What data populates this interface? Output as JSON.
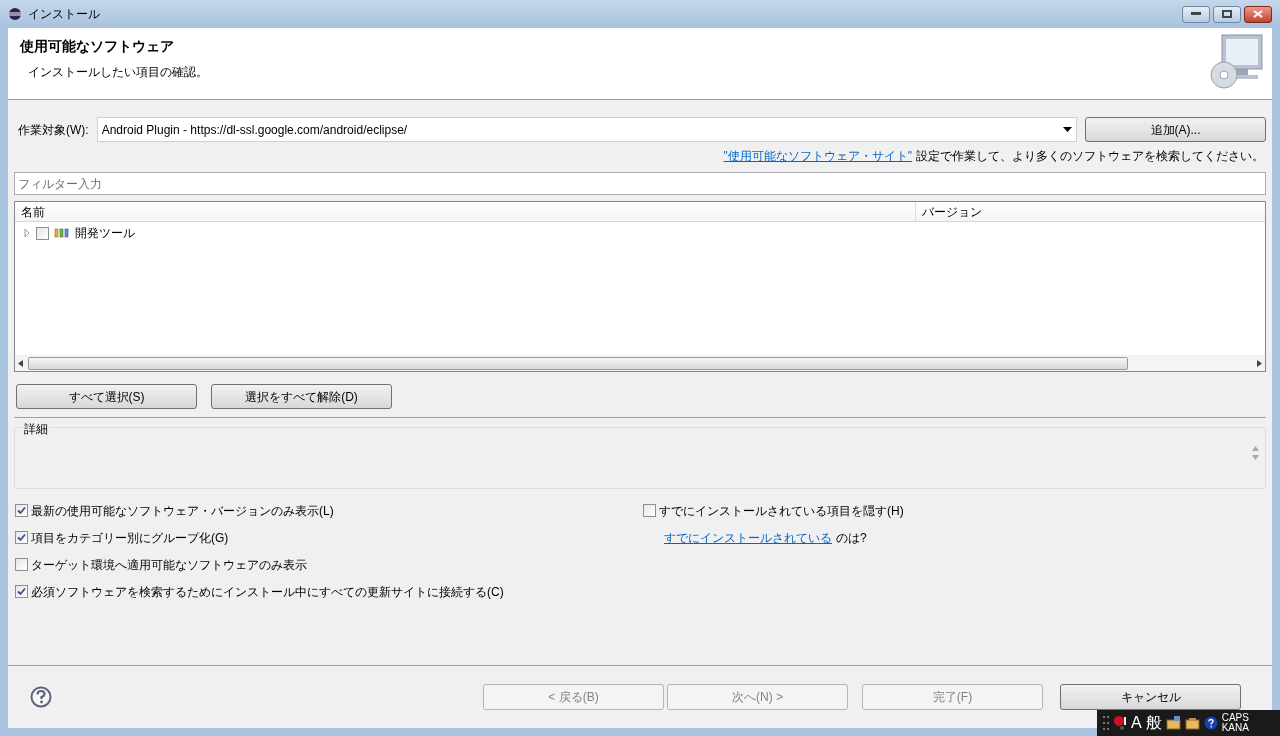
{
  "window": {
    "title": "インストール"
  },
  "header": {
    "title": "使用可能なソフトウェア",
    "subtitle": "インストールしたい項目の確認。"
  },
  "work_with": {
    "label": "作業対象(W):",
    "value": "Android Plugin - https://dl-ssl.google.com/android/eclipse/",
    "add_button": "追加(A)..."
  },
  "site_note": {
    "link": "\"使用可能なソフトウェア・サイト\"",
    "text": "設定で作業して、より多くのソフトウェアを検索してください。"
  },
  "filter": {
    "placeholder": "フィルター入力"
  },
  "tree": {
    "columns": [
      "名前",
      "バージョン"
    ],
    "items": [
      {
        "label": "開発ツール",
        "checked": false,
        "expanded": false
      }
    ]
  },
  "selection_buttons": [
    "すべて選択(S)",
    "選択をすべて解除(D)"
  ],
  "details": {
    "label": "詳細"
  },
  "options_left": [
    {
      "label": "最新の使用可能なソフトウェア・バージョンのみ表示(L)",
      "checked": true
    },
    {
      "label": "項目をカテゴリー別にグループ化(G)",
      "checked": true
    },
    {
      "label": "ターゲット環境へ適用可能なソフトウェアのみ表示",
      "checked": false
    },
    {
      "label": "必須ソフトウェアを検索するためにインストール中にすべての更新サイトに接続する(C)",
      "checked": true
    }
  ],
  "hide_installed": {
    "label": "すでにインストールされている項目を隠す(H)",
    "checked": false
  },
  "installed_note": {
    "link": "すでにインストールされている",
    "text": "のは?"
  },
  "footer_buttons": [
    {
      "label": "< 戻る(B)",
      "disabled": true
    },
    {
      "label": "次へ(N) >",
      "disabled": true
    },
    {
      "label": "完了(F)",
      "disabled": true
    },
    {
      "label": "キャンセル",
      "disabled": false
    }
  ],
  "ime_bar": {
    "mode": "A",
    "conversion": "般",
    "caps": "CAPS",
    "kana": "KANA"
  }
}
